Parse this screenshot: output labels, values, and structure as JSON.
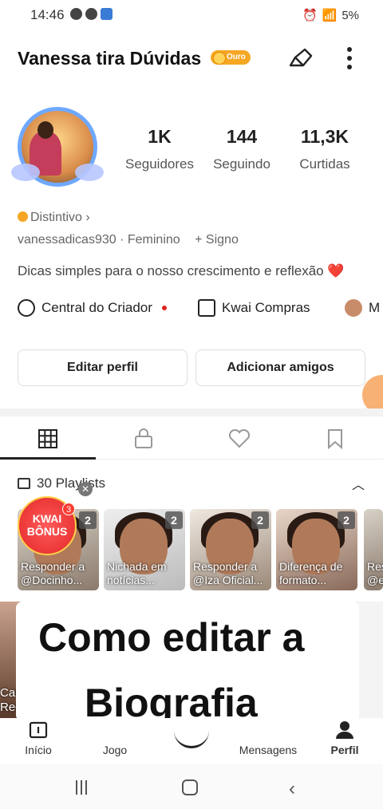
{
  "status_bar": {
    "time": "14:46",
    "battery": "5%"
  },
  "header": {
    "title": "Vanessa tira Dúvidas",
    "badge": "Ouro"
  },
  "stats": [
    {
      "value": "1K",
      "label": "Seguidores"
    },
    {
      "value": "144",
      "label": "Seguindo"
    },
    {
      "value": "11,3K",
      "label": "Curtidas"
    }
  ],
  "profile": {
    "distintivo": "Distintivo ›",
    "username": "vanessadicas930",
    "gender": "Feminino",
    "sign": "+ Signo",
    "bio": "Dicas simples para o nosso crescimento e reflexão",
    "bio_emoji": "❤️"
  },
  "quick_links": {
    "creator": "Central do Criador",
    "shop": "Kwai Compras",
    "cut": "M"
  },
  "buttons": {
    "edit": "Editar perfil",
    "add_friends": "Adicionar amigos"
  },
  "playlists": {
    "label": "30 Playlists",
    "items": [
      {
        "count": "2",
        "caption": "Responder a @Docinho..."
      },
      {
        "count": "2",
        "caption": "Nichada em notícias..."
      },
      {
        "count": "2",
        "caption": "Responder a @Iza Oficial..."
      },
      {
        "count": "2",
        "caption": "Diferença de formato..."
      },
      {
        "count": "",
        "caption": "Res @e"
      }
    ]
  },
  "kwai_bonus": {
    "title": "KWAI BÔNUS",
    "badge": "3"
  },
  "overlay": {
    "line1": "Como editar a",
    "line2": "Biografia",
    "left_caption": "Caixa de Recompensas"
  },
  "bottom_nav": [
    {
      "label": "Início"
    },
    {
      "label": "Jogo"
    },
    {
      "label": ""
    },
    {
      "label": "Mensagens"
    },
    {
      "label": "Perfil"
    }
  ],
  "colors": {
    "gold": "#f5a623",
    "red": "#e0221f",
    "accent_orange": "#f7a35c"
  }
}
